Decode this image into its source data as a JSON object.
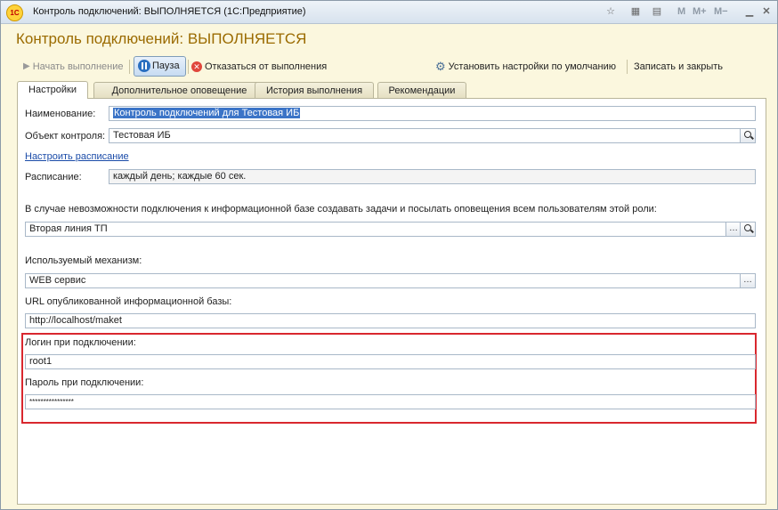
{
  "window": {
    "title": "Контроль подключений: ВЫПОЛНЯЕТСЯ  (1С:Предприятие)",
    "app_icon_text": "1С",
    "toolbar_m": [
      "M",
      "M+",
      "M−"
    ]
  },
  "form": {
    "title": "Контроль подключений: ВЫПОЛНЯЕТСЯ"
  },
  "commands": {
    "start": "Начать выполнение",
    "pause": "Пауза",
    "cancel": "Отказаться от выполнения",
    "defaults": "Установить настройки по умолчанию",
    "save_close": "Записать и закрыть"
  },
  "tabs": [
    "Настройки",
    "Дополнительное оповещение",
    "История выполнения",
    "Рекомендации"
  ],
  "fields": {
    "name_label": "Наименование:",
    "name_value": "Контроль подключений для Тестовая ИБ",
    "object_label": "Объект контроля:",
    "object_value": "Тестовая ИБ",
    "schedule_link": "Настроить расписание",
    "schedule_label": "Расписание:",
    "schedule_value": "каждый  день; каждые 60 сек.",
    "role_label": "В случае невозможности подключения к информационной базе создавать задачи и посылать оповещения всем пользователям этой роли:",
    "role_value": "Вторая линия ТП",
    "mechanism_label": "Используемый механизм:",
    "mechanism_value": "WEB сервис",
    "url_label": "URL опубликованной информационной базы:",
    "url_value": "http://localhost/maket",
    "login_label": "Логин при подключении:",
    "login_value": "root1",
    "password_label": "Пароль при подключении:",
    "password_value": "****************"
  },
  "colors": {
    "title_accent": "#9b6b00",
    "highlight_box": "#d9272e",
    "form_bg": "#fbf7de",
    "link": "#1a4ba8"
  }
}
